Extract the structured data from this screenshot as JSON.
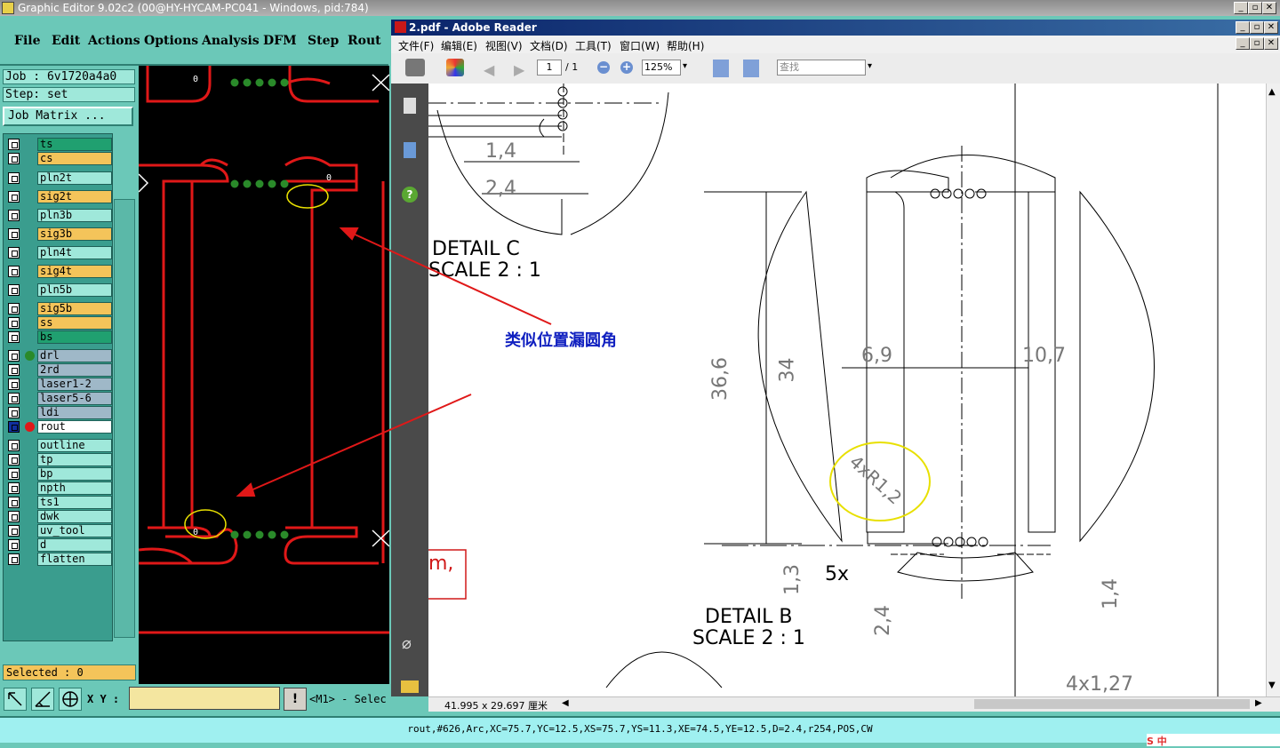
{
  "genesis": {
    "title": "Graphic Editor 9.02c2 (00@HY-HYCAM-PC041 - Windows, pid:784)",
    "menu": [
      "File",
      "Edit",
      "Actions",
      "Options",
      "Analysis",
      "DFM",
      "Step",
      "Rout"
    ],
    "job": "Job : 6v1720a4a0",
    "step": "Step: set",
    "job_matrix": "Job Matrix ...",
    "layers": [
      {
        "name": "ts",
        "color": "#20a070"
      },
      {
        "name": "cs",
        "color": "#f4c45a"
      },
      {
        "name": "pln2t",
        "color": "#9fe8da"
      },
      {
        "name": "sig2t",
        "color": "#f4c45a"
      },
      {
        "name": "pln3b",
        "color": "#9fe8da"
      },
      {
        "name": "sig3b",
        "color": "#f4c45a"
      },
      {
        "name": "pln4t",
        "color": "#9fe8da"
      },
      {
        "name": "sig4t",
        "color": "#f4c45a"
      },
      {
        "name": "pln5b",
        "color": "#9fe8da"
      },
      {
        "name": "sig5b",
        "color": "#f4c45a"
      },
      {
        "name": "ss",
        "color": "#f4c45a"
      },
      {
        "name": "bs",
        "color": "#20a070"
      },
      {
        "name": "drl",
        "color": "#9fb8c8"
      },
      {
        "name": "2rd",
        "color": "#9fb8c8"
      },
      {
        "name": "laser1-2",
        "color": "#9fb8c8"
      },
      {
        "name": "laser5-6",
        "color": "#9fb8c8"
      },
      {
        "name": "ldi",
        "color": "#9fb8c8"
      },
      {
        "name": "rout",
        "color": "#ffffff"
      },
      {
        "name": "outline",
        "color": "#9fe8da"
      },
      {
        "name": "tp",
        "color": "#9fe8da"
      },
      {
        "name": "bp",
        "color": "#9fe8da"
      },
      {
        "name": "npth",
        "color": "#9fe8da"
      },
      {
        "name": "ts1",
        "color": "#9fe8da"
      },
      {
        "name": "dwk",
        "color": "#9fe8da"
      },
      {
        "name": "uv_tool",
        "color": "#9fe8da"
      },
      {
        "name": "d",
        "color": "#9fe8da"
      },
      {
        "name": "flatten",
        "color": "#9fe8da"
      }
    ],
    "selected": "Selected : 0",
    "xy_label": "X Y :",
    "xy_value": "",
    "mouse_hint": "<M1> - Selec",
    "status": "rout,#626,Arc,XC=75.7,YC=12.5,XS=75.7,YS=11.3,XE=74.5,YE=12.5,D=2.4,r254,POS,CW",
    "canvas_marks": [
      "0",
      "0",
      "0"
    ]
  },
  "reader": {
    "title": "2.pdf - Adobe Reader",
    "menu": [
      "文件(F)",
      "编辑(E)",
      "视图(V)",
      "文档(D)",
      "工具(T)",
      "窗口(W)",
      "帮助(H)"
    ],
    "page_current": "1",
    "page_total": "/ 1",
    "zoom": "125%",
    "find_placeholder": "查找",
    "page_size": "41.995 x 29.697 厘米",
    "drawing": {
      "detail_c": "DETAIL C",
      "scale_c": "SCALE 2 : 1",
      "detail_b": "DETAIL B",
      "scale_b": "SCALE 2 : 1",
      "dims": [
        "1,4",
        "2,4",
        "36,6",
        "34",
        "6,9",
        "10,7",
        "4xR1,2",
        "1,3",
        "5x",
        "2,4",
        "1,4",
        "4x1,27"
      ],
      "red_text": "m,"
    }
  },
  "annotation": "类似位置漏圆角",
  "tray": "S 中"
}
